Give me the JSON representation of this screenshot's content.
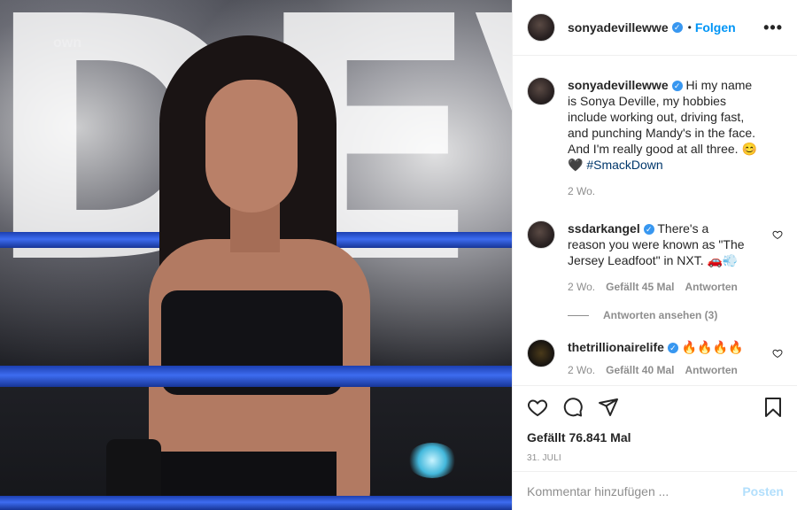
{
  "photo": {
    "watermark": "own",
    "backdrop_letters": "DEV"
  },
  "post": {
    "author": "sonyadevillewwe",
    "verified": true,
    "follow_separator": "•",
    "follow_label": "Folgen",
    "more_label": "•••"
  },
  "caption": {
    "username": "sonyadevillewwe",
    "text": "Hi my name is Sonya Deville, my hobbies include working out, driving fast, and punching Mandy's in the face. And I'm really good at all three. 😊🖤",
    "hashtag": "#SmackDown",
    "time": "2 Wo."
  },
  "comments": [
    {
      "username": "ssdarkangel",
      "verified": true,
      "text": "There's a reason you were known as \"The Jersey Leadfoot\" in NXT. 🚗💨",
      "time": "2 Wo.",
      "likes": "Gefällt 45 Mal",
      "reply": "Antworten",
      "view_replies": "Antworten ansehen (3)"
    },
    {
      "username": "thetrillionairelife",
      "verified": true,
      "text": "🔥🔥🔥🔥",
      "time": "2 Wo.",
      "likes": "Gefällt 40 Mal",
      "reply": "Antworten"
    }
  ],
  "actions": {
    "like_icon": "heart-icon",
    "comment_icon": "comment-icon",
    "share_icon": "share-icon",
    "save_icon": "bookmark-icon"
  },
  "likes_total": "Gefällt 76.841 Mal",
  "date": "31. JULI",
  "add_comment": {
    "placeholder": "Kommentar hinzufügen ...",
    "post_label": "Posten"
  },
  "colors": {
    "accent": "#0095f6",
    "verified": "#3897f0",
    "muted": "#8e8e8e",
    "rope": "#2f5ee0"
  }
}
